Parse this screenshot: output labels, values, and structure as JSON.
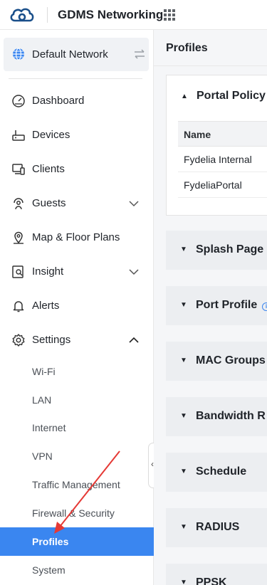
{
  "header": {
    "app_title": "GDMS Networking"
  },
  "sidebar": {
    "network": "Default Network",
    "items": [
      {
        "label": "Dashboard"
      },
      {
        "label": "Devices"
      },
      {
        "label": "Clients"
      },
      {
        "label": "Guests"
      },
      {
        "label": "Map & Floor Plans"
      },
      {
        "label": "Insight"
      },
      {
        "label": "Alerts"
      },
      {
        "label": "Settings"
      }
    ],
    "settings_sub": [
      {
        "label": "Wi-Fi"
      },
      {
        "label": "LAN"
      },
      {
        "label": "Internet"
      },
      {
        "label": "VPN"
      },
      {
        "label": "Traffic Management"
      },
      {
        "label": "Firewall & Security"
      },
      {
        "label": "Profiles",
        "active": true
      },
      {
        "label": "System"
      }
    ]
  },
  "main": {
    "page_title": "Profiles",
    "panels": [
      {
        "title": "Portal Policy",
        "expanded": true
      },
      {
        "title": "Splash Page"
      },
      {
        "title": "Port Profile"
      },
      {
        "title": "MAC Groups"
      },
      {
        "title": "Bandwidth R"
      },
      {
        "title": "Schedule"
      },
      {
        "title": "RADIUS"
      },
      {
        "title": "PPSK"
      }
    ],
    "portal_table": {
      "header": "Name",
      "rows": [
        "Fydelia Internal",
        "FydeliaPortal"
      ]
    }
  },
  "colors": {
    "accent": "#3a86f0",
    "annotation_arrow": "#e53935"
  }
}
